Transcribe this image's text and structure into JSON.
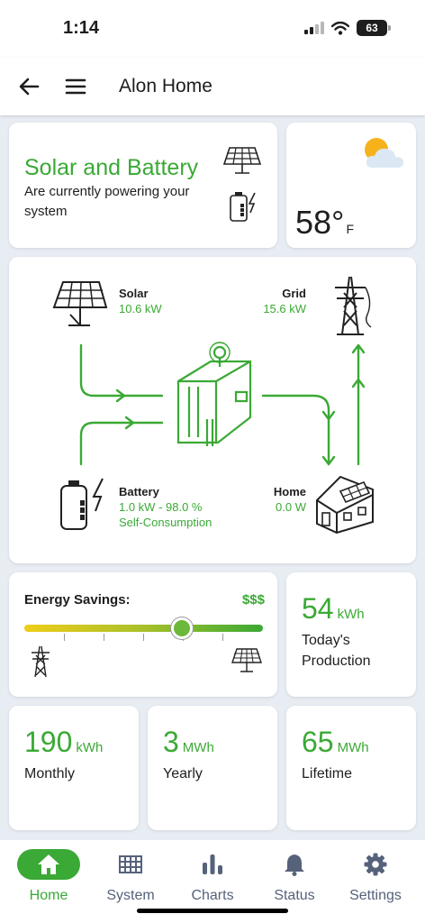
{
  "status_bar": {
    "time": "1:14",
    "battery": "63"
  },
  "header": {
    "title": "Alon Home"
  },
  "power_status": {
    "headline": "Solar and Battery",
    "subtext": "Are currently powering your system"
  },
  "weather": {
    "temperature": "58°",
    "unit": "F"
  },
  "energy_flow": {
    "solar": {
      "name": "Solar",
      "value": "10.6 kW"
    },
    "grid": {
      "name": "Grid",
      "value": "15.6 kW"
    },
    "battery": {
      "name": "Battery",
      "value": "1.0 kW - 98.0 %",
      "mode": "Self-Consumption"
    },
    "home": {
      "name": "Home",
      "value": "0.0 W"
    }
  },
  "savings": {
    "label": "Energy Savings:",
    "indicator": "$$$",
    "slider_level": 0.66
  },
  "stats": {
    "today": {
      "value": "54",
      "unit": "kWh",
      "label": "Today's Production"
    },
    "monthly": {
      "value": "190",
      "unit": "kWh",
      "label": "Monthly"
    },
    "yearly": {
      "value": "3",
      "unit": "MWh",
      "label": "Yearly"
    },
    "lifetime": {
      "value": "65",
      "unit": "MWh",
      "label": "Lifetime"
    }
  },
  "nav": [
    {
      "label": "Home",
      "icon": "home-icon",
      "active": true
    },
    {
      "label": "System",
      "icon": "grid-icon",
      "active": false
    },
    {
      "label": "Charts",
      "icon": "bar-chart-icon",
      "active": false
    },
    {
      "label": "Status",
      "icon": "bell-icon",
      "active": false
    },
    {
      "label": "Settings",
      "icon": "gear-icon",
      "active": false
    }
  ],
  "colors": {
    "accent": "#3aa935",
    "background": "#e8ecf3",
    "nav_inactive": "#56627a"
  }
}
